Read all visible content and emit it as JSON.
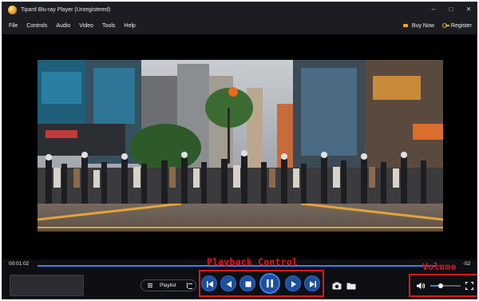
{
  "window": {
    "title": "Tipard Blu-ray Player (Unregistered)",
    "controls": {
      "minimize": "–",
      "maximize": "□",
      "close": "✕"
    }
  },
  "menu": {
    "items": [
      "File",
      "Controls",
      "Audio",
      "Video",
      "Tools",
      "Help"
    ],
    "buy_now": "Buy Now",
    "register": "Register"
  },
  "player": {
    "elapsed": "00:01:02",
    "remaining": "-52",
    "progress_fraction": 0.98,
    "volume_fraction": 0.35,
    "playlist_label": "Playlist",
    "state": "playing"
  },
  "controls": {
    "icons": [
      "skip-previous-icon",
      "rewind-icon",
      "stop-icon",
      "pause-icon",
      "fast-forward-icon",
      "skip-next-icon",
      "snapshot-camera-icon",
      "open-folder-icon",
      "volume-icon",
      "fullscreen-icon"
    ]
  },
  "annotations": {
    "playback": "Playback Control",
    "volume": "Volume"
  },
  "colors": {
    "accent": "#3c7df0",
    "button_fill": "#1d4f9c",
    "annotation": "#e0181b",
    "background": "#0e0f13"
  }
}
